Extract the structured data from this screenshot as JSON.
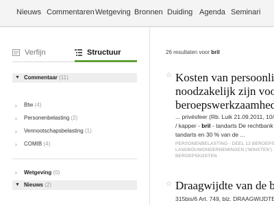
{
  "nav": {
    "items": [
      "Nieuws",
      "Commentaren",
      "Wetgeving",
      "Bronnen",
      "Duiding",
      "Agenda",
      "Seminari"
    ]
  },
  "sidebar": {
    "tabs": [
      {
        "label": "Verfijn",
        "icon": "filter-icon"
      },
      {
        "label": "Structuur",
        "icon": "tree-structure-icon"
      }
    ],
    "active_tab": "Structuur",
    "accent_color": "#5b9f2e",
    "commentaar": {
      "label": "Commentaar",
      "count": "(11)"
    },
    "commentaar_items": [
      {
        "label": "Btw",
        "count": "(4)"
      },
      {
        "label": "Personenbelasting",
        "count": "(2)"
      },
      {
        "label": "Vennootschapsbelasting",
        "count": "(1)"
      },
      {
        "label": "COMIB",
        "count": "(4)"
      }
    ],
    "wetgeving": {
      "label": "Wetgeving",
      "count": "(0)"
    },
    "nieuws": {
      "label": "Nieuws",
      "count": "(2)"
    }
  },
  "results": {
    "count_text": "26 resultaten voor",
    "query": "bril",
    "items": [
      {
        "title_lines": [
          "Kosten van persoonlijke",
          "noodzakelijk zijn voor",
          "beroepswerkzaamheden"
        ],
        "snippet_line1": "... privésfeer (Rb. Luik 21.09.2011, 10/",
        "snippet_line2_pre": "/ kapper - ",
        "snippet_line2_hl": "bril",
        "snippet_line2_post": " - tandarts De rechtbank",
        "snippet_line3": "tandarts en 30 % van de ...",
        "meta_lines": [
          "PERSONENBELASTING - DEEL 13 BEROEPSINKOMSTEN -",
          "LANDBOUWONDERNEMINGEN ('WINSTEN') - HOOFDSTUK",
          "BEROEPSKOSTEN"
        ]
      },
      {
        "title_lines": [
          "Draagwijdte van de bepaling"
        ],
        "snippet_line1": "315bis/6 Art. 749, blz. DRAAGWIJDTE"
      }
    ]
  }
}
